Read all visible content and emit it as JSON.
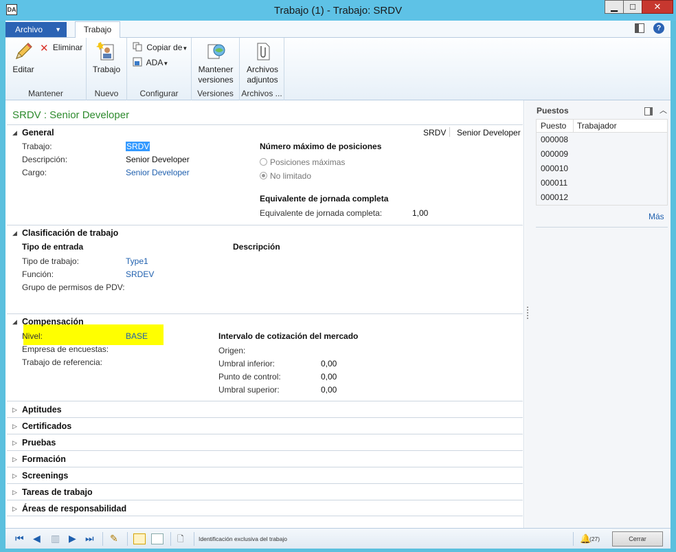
{
  "window": {
    "title": "Trabajo (1) - Trabajo: SRDV",
    "app_icon": "DA",
    "minimize": "▁",
    "maximize": "□",
    "close": "✕"
  },
  "tabs": {
    "archivo": "Archivo",
    "trabajo": "Trabajo"
  },
  "ribbon": {
    "groups": [
      {
        "label": "Mantener",
        "buttons": {
          "editar": "Editar",
          "eliminar": "Eliminar"
        }
      },
      {
        "label": "Nuevo",
        "buttons": {
          "trabajo": "Trabajo"
        }
      },
      {
        "label": "Configurar",
        "buttons": {
          "copiar": "Copiar de",
          "ada": "ADA"
        }
      },
      {
        "label": "Versiones",
        "buttons": {
          "mantener_l1": "Mantener",
          "mantener_l2": "versiones"
        }
      },
      {
        "label": "Archivos ...",
        "buttons": {
          "archivos_l1": "Archivos",
          "archivos_l2": "adjuntos"
        }
      }
    ]
  },
  "form": {
    "title": "SRDV : Senior Developer",
    "general": {
      "header": "General",
      "summary_id": "SRDV",
      "summary_desc": "Senior Developer",
      "trabajo_label": "Trabajo:",
      "trabajo_value": "SRDV",
      "descripcion_label": "Descripción:",
      "descripcion_value": "Senior Developer",
      "cargo_label": "Cargo:",
      "cargo_value": "Senior Developer",
      "max_pos_header": "Número máximo de posiciones",
      "radio_max": "Posiciones máximas",
      "radio_unlimited": "No limitado",
      "fte_header": "Equivalente de jornada completa",
      "fte_label": "Equivalente de jornada completa:",
      "fte_value": "1,00"
    },
    "clasificacion": {
      "header": "Clasificación de trabajo",
      "tipo_entrada": "Tipo de entrada",
      "descripcion": "Descripción",
      "tipo_label": "Tipo de trabajo:",
      "tipo_value": "Type1",
      "funcion_label": "Función:",
      "funcion_value": "SRDEV",
      "grupo_label": "Grupo de permisos de PDV:"
    },
    "compensacion": {
      "header": "Compensación",
      "nivel_label": "Nivel:",
      "nivel_value": "BASE",
      "empresa_label": "Empresa de encuestas:",
      "referencia_label": "Trabajo de referencia:",
      "intervalo_header": "Intervalo de cotización del mercado",
      "origen_label": "Origen:",
      "umbral_inf_label": "Umbral inferior:",
      "umbral_inf_value": "0,00",
      "punto_label": "Punto de control:",
      "punto_value": "0,00",
      "umbral_sup_label": "Umbral superior:",
      "umbral_sup_value": "0,00"
    },
    "collapsed": [
      "Aptitudes",
      "Certificados",
      "Pruebas",
      "Formación",
      "Screenings",
      "Tareas de trabajo",
      "Áreas de responsabilidad"
    ]
  },
  "factbox": {
    "title": "Puestos",
    "col_puesto": "Puesto",
    "col_trabajador": "Trabajador",
    "rows": [
      "000008",
      "000009",
      "000010",
      "000011",
      "000012"
    ],
    "more": "Más"
  },
  "statusbar": {
    "text": "Identificación exclusiva del trabajo",
    "notif_count": "(27)",
    "close": "Cerrar"
  }
}
